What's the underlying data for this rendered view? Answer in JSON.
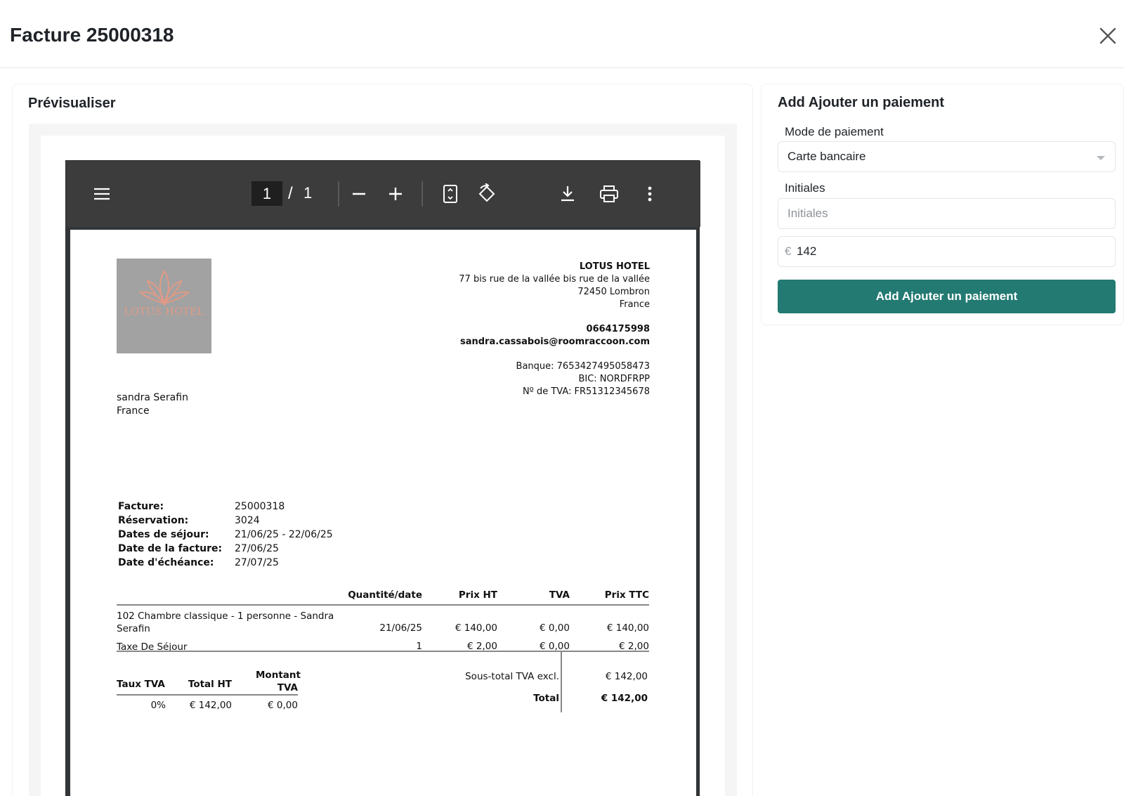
{
  "modal": {
    "title": "Facture 25000318",
    "close_icon": "close-icon"
  },
  "preview": {
    "title": "Prévisualiser",
    "pdf_toolbar": {
      "current_page": "1",
      "separator": "/",
      "total_pages": "1",
      "icons": [
        "menu-icon",
        "zoom-out-icon",
        "zoom-in-icon",
        "fit-page-icon",
        "rotate-icon",
        "download-icon",
        "print-icon",
        "more-vert-icon"
      ]
    },
    "invoice": {
      "logo_text": "LOTUS HOTEL",
      "hotel_name": "LOTUS HOTEL",
      "address_line1": "77 bis rue de la vallée bis rue de la vallée",
      "address_line2": "72450 Lombron",
      "address_line3": "France",
      "phone": "0664175998",
      "email": "sandra.cassabois@roomraccoon.com",
      "bank": "Banque: 7653427495058473",
      "bic": "BIC: NORDFRPP",
      "vat_number": "Nº de TVA: FR51312345678",
      "client_name": "sandra Serafin",
      "client_country": "France",
      "meta": [
        {
          "label": "Facture:",
          "value": "25000318"
        },
        {
          "label": "Réservation:",
          "value": "3024"
        },
        {
          "label": "Dates de séjour:",
          "value": "21/06/25 - 22/06/25"
        },
        {
          "label": "Date de la facture:",
          "value": "27/06/25"
        },
        {
          "label": "Date d'échéance:",
          "value": "27/07/25"
        }
      ],
      "line_headers": {
        "qty": "Quantité/date",
        "ht": "Prix HT",
        "tva": "TVA",
        "ttc": "Prix TTC"
      },
      "lines": [
        {
          "desc": "102 Chambre classique - 1 personne - Sandra Serafin",
          "qty": "21/06/25",
          "ht": "€ 140,00",
          "tva": "€ 0,00",
          "ttc": "€ 140,00"
        },
        {
          "desc": "Taxe De Séjour",
          "qty": "1",
          "ht": "€ 2,00",
          "tva": "€ 0,00",
          "ttc": "€ 2,00"
        }
      ],
      "vat_headers": {
        "rate": "Taux TVA",
        "ht": "Total HT",
        "amount": "Montant TVA"
      },
      "vat_rows": [
        {
          "rate": "0%",
          "ht": "€ 142,00",
          "amount": "€ 0,00"
        }
      ],
      "subtotal_label": "Sous-total TVA excl.",
      "subtotal_value": "€ 142,00",
      "total_label": "Total",
      "total_value": "€ 142,00"
    }
  },
  "payment": {
    "title": "Add Ajouter un paiement",
    "method_label": "Mode de paiement",
    "method_value": "Carte bancaire",
    "initials_label": "Initiales",
    "initials_placeholder": "Initiales",
    "currency_symbol": "€",
    "amount_value": "142",
    "submit_label": "Add Ajouter un paiement"
  }
}
